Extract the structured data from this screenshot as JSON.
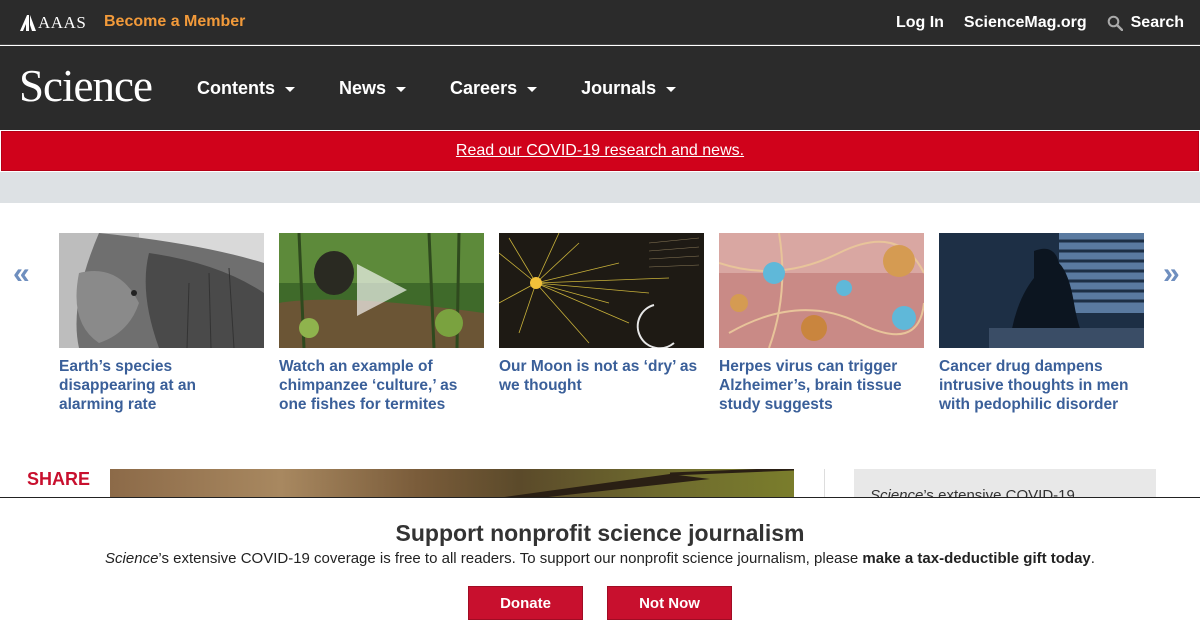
{
  "topbar": {
    "logo_text": "AAAS",
    "member_link": "Become a Member",
    "login": "Log In",
    "sciencemag": "ScienceMag.org",
    "search": "Search"
  },
  "navbar": {
    "brand": "Science",
    "items": [
      {
        "label": "Contents"
      },
      {
        "label": "News"
      },
      {
        "label": "Careers"
      },
      {
        "label": "Journals"
      }
    ]
  },
  "banner": {
    "covid_link": "Read our COVID-19 research and news."
  },
  "carousel": {
    "prev_arrow": "«",
    "next_arrow": "»",
    "cards": [
      {
        "title": "Earth’s species disappearing at an alarming rate"
      },
      {
        "title": "Watch an example of chimpanzee ‘culture,’ as one fishes for termites"
      },
      {
        "title": "Our Moon is not as ‘dry’ as we thought"
      },
      {
        "title": "Herpes virus can trigger Alzheimer’s, brain tissue study suggests"
      },
      {
        "title": "Cancer drug dampens intrusive thoughts in men with pedophilic disorder"
      }
    ]
  },
  "article": {
    "share_label": "SHARE",
    "side_box_italic": "Science",
    "side_box_rest": "’s extensive COVID-19"
  },
  "donate": {
    "title": "Support nonprofit science journalism",
    "text_italic": "Science",
    "text_middle": "’s extensive COVID-19 coverage is free to all readers. To support our nonprofit science journalism, please ",
    "text_bold": "make a tax-deductible gift today",
    "text_end": ".",
    "donate_button": "Donate",
    "not_now_button": "Not Now"
  },
  "colors": {
    "header_bg": "#2b2b2b",
    "accent_orange": "#f29a3a",
    "banner_red": "#d0021b",
    "link_blue": "#3a5f99",
    "button_red": "#c8102e"
  }
}
